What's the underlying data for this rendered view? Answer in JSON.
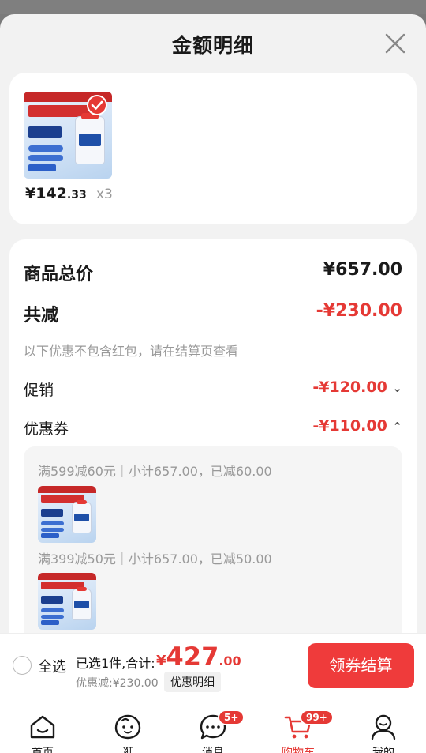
{
  "sheet": {
    "title": "金额明细"
  },
  "item": {
    "price_main": "¥142",
    "price_dec": ".33",
    "qty": "x3"
  },
  "summary": {
    "total_label": "商品总价",
    "total_value": "¥657.00",
    "reduce_label": "共减",
    "reduce_value": "-¥230.00",
    "note": "以下优惠不包含红包，请在结算页查看",
    "promo_label": "促销",
    "promo_value": "-¥120.00",
    "promo_arrow": "⌄",
    "coupon_label": "优惠券",
    "coupon_value": "-¥110.00",
    "coupon_arrow": "⌃"
  },
  "coupons": [
    {
      "text": "满599减60元｜小计657.00，已减60.00"
    },
    {
      "text": "满399减50元｜小计657.00，已减50.00"
    }
  ],
  "bottom": {
    "select_all": "全选",
    "selected": "已选1件,合计:",
    "total_yen": "¥",
    "total_int": "427",
    "total_dec": ".00",
    "reduced": "优惠减:¥230.00",
    "detail_btn": "优惠明细",
    "checkout_btn": "领券结算"
  },
  "tabs": [
    {
      "label": "首页",
      "icon": "home-icon"
    },
    {
      "label": "逛",
      "icon": "discover-icon"
    },
    {
      "label": "消息",
      "icon": "message-icon",
      "badge": "5+"
    },
    {
      "label": "购物车",
      "icon": "cart-icon",
      "badge": "99+",
      "active": true
    },
    {
      "label": "我的",
      "icon": "profile-icon"
    }
  ],
  "colors": {
    "accent": "#e53935",
    "checkout": "#ef3b3b"
  }
}
